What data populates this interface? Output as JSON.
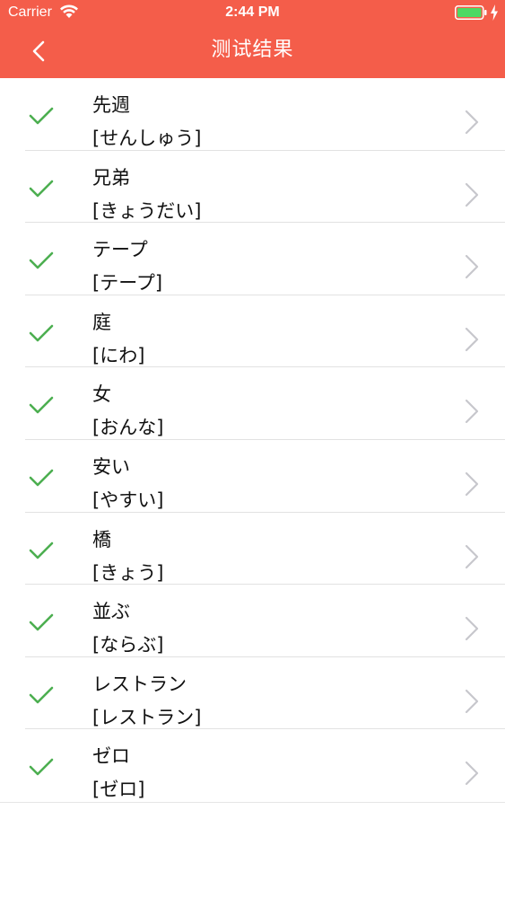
{
  "status_bar": {
    "carrier": "Carrier",
    "time": "2:44 PM"
  },
  "nav": {
    "title": "测试结果",
    "back_icon": "chevron-left-icon"
  },
  "colors": {
    "header_bg": "#f45d4a",
    "check_green": "#4caf50",
    "battery_green": "#4cd964"
  },
  "results": [
    {
      "word": "先週",
      "reading": "[せんしゅう]",
      "correct": true
    },
    {
      "word": "兄弟",
      "reading": "[きょうだい]",
      "correct": true
    },
    {
      "word": "テープ",
      "reading": "[テープ]",
      "correct": true
    },
    {
      "word": "庭",
      "reading": "[にわ]",
      "correct": true
    },
    {
      "word": "女",
      "reading": "[おんな]",
      "correct": true
    },
    {
      "word": "安い",
      "reading": "[やすい]",
      "correct": true
    },
    {
      "word": "橋",
      "reading": "[きょう]",
      "correct": true
    },
    {
      "word": "並ぶ",
      "reading": "[ならぶ]",
      "correct": true
    },
    {
      "word": "レストラン",
      "reading": "[レストラン]",
      "correct": true
    },
    {
      "word": "ゼロ",
      "reading": "[ゼロ]",
      "correct": true
    }
  ]
}
